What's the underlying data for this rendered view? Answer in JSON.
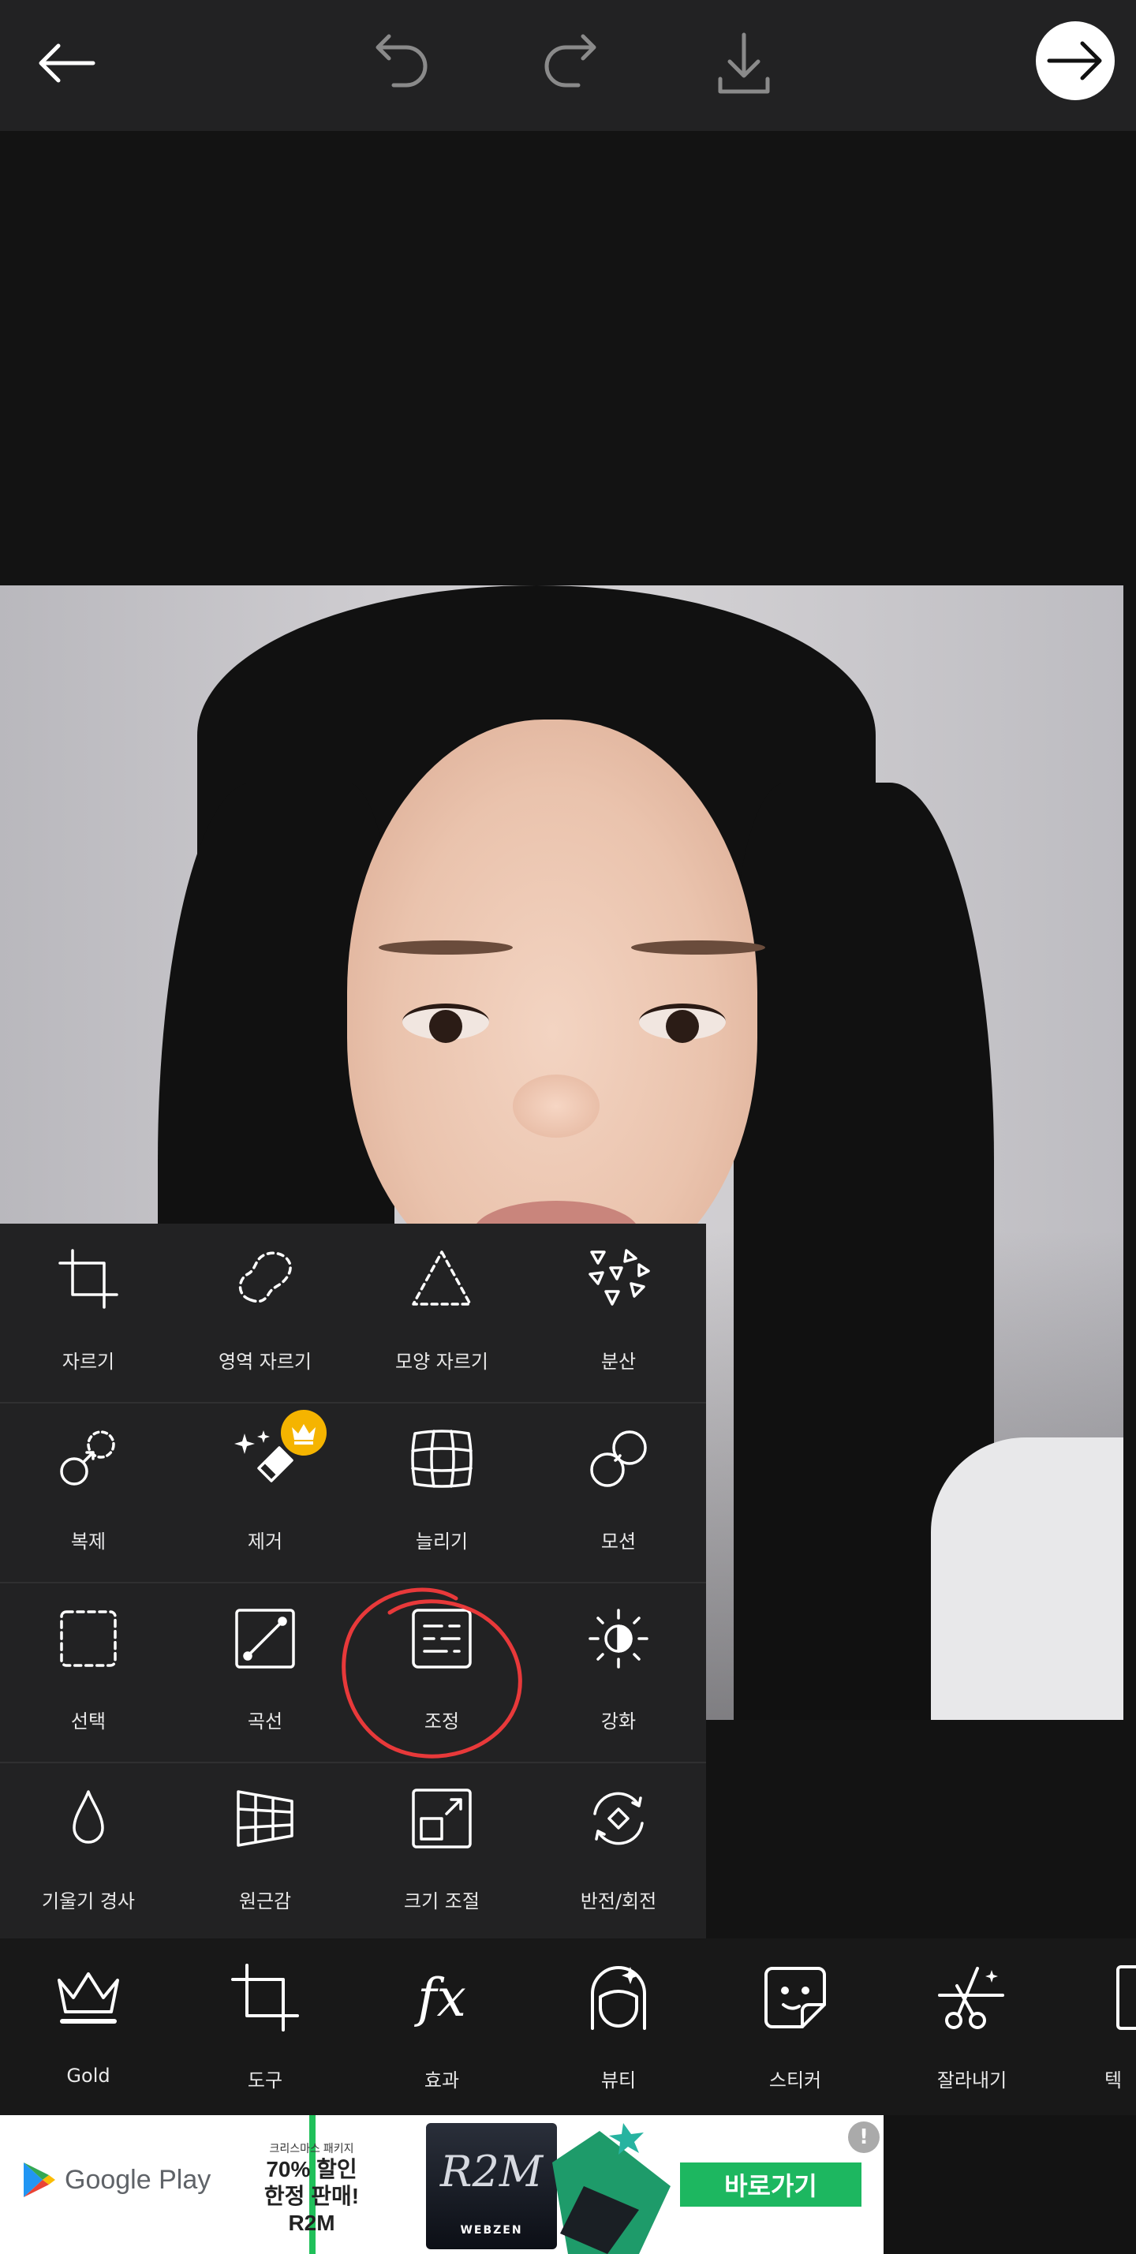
{
  "colors": {
    "accent_green": "#1db760",
    "badge_gold": "#f5b400",
    "annotation_red": "#e8393a"
  },
  "top_bar": {
    "back_icon": "arrow-left-icon",
    "undo_icon": "undo-icon",
    "redo_icon": "redo-icon",
    "download_icon": "download-icon",
    "next_icon": "arrow-right-icon"
  },
  "tools": [
    {
      "label": "자르기",
      "icon": "crop-icon"
    },
    {
      "label": "영역 자르기",
      "icon": "freecrop-icon"
    },
    {
      "label": "모양 자르기",
      "icon": "shape-crop-icon"
    },
    {
      "label": "분산",
      "icon": "dispersion-icon"
    },
    {
      "label": "복제",
      "icon": "clone-icon"
    },
    {
      "label": "제거",
      "icon": "remove-icon",
      "premium": true
    },
    {
      "label": "늘리기",
      "icon": "stretch-icon"
    },
    {
      "label": "모션",
      "icon": "motion-icon"
    },
    {
      "label": "선택",
      "icon": "select-icon"
    },
    {
      "label": "곡선",
      "icon": "curves-icon"
    },
    {
      "label": "조정",
      "icon": "adjust-icon",
      "highlighted": true
    },
    {
      "label": "강화",
      "icon": "enhance-icon"
    },
    {
      "label": "기울기 경사",
      "icon": "tilt-shift-icon"
    },
    {
      "label": "원근감",
      "icon": "perspective-icon"
    },
    {
      "label": "크기 조절",
      "icon": "resize-icon"
    },
    {
      "label": "반전/회전",
      "icon": "flip-rotate-icon"
    }
  ],
  "bottom_nav": [
    {
      "label": "Gold",
      "icon": "crown-icon"
    },
    {
      "label": "도구",
      "icon": "crop-tool-icon"
    },
    {
      "label": "효과",
      "icon": "fx-icon",
      "glyph": "fx"
    },
    {
      "label": "뷰티",
      "icon": "beauty-face-icon"
    },
    {
      "label": "스티커",
      "icon": "sticker-icon"
    },
    {
      "label": "잘라내기",
      "icon": "cutout-scissors-icon"
    },
    {
      "label": "텍",
      "icon": "text-icon"
    }
  ],
  "ad": {
    "store": "Google Play",
    "promo_small": "크리스마스 패키지",
    "promo_line1": "70% 할인",
    "promo_line2": "한정 판매!",
    "promo_line3": "R2M",
    "logo_text": "R2M",
    "logo_sub": "WEBZEN",
    "cta": "바로가기",
    "info": "!"
  }
}
